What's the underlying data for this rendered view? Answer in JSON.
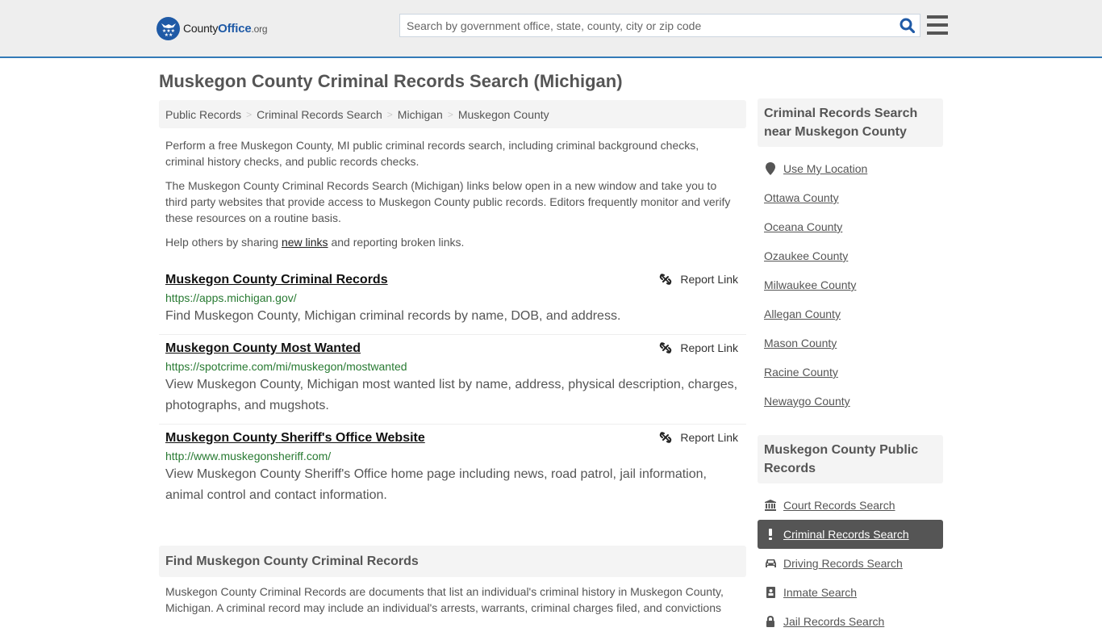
{
  "header": {
    "logo": {
      "name": "County",
      "highlight": "Office",
      "suffix": ".org"
    },
    "search": {
      "placeholder": "Search by government office, state, county, city or zip code",
      "value": ""
    },
    "accent_color": "#337ab7"
  },
  "page": {
    "title": "Muskegon County Criminal Records Search (Michigan)"
  },
  "breadcrumb": [
    "Public Records",
    "Criminal Records Search",
    "Michigan",
    "Muskegon County"
  ],
  "intro": {
    "p1": "Perform a free Muskegon County, MI public criminal records search, including criminal background checks, criminal history checks, and public records checks.",
    "p2": "The Muskegon County Criminal Records Search (Michigan) links below open in a new window and take you to third party websites that provide access to Muskegon County public records. Editors frequently monitor and verify these resources on a routine basis.",
    "p3_before": "Help others by sharing ",
    "p3_link": "new links",
    "p3_after": " and reporting broken links."
  },
  "links": [
    {
      "title": "Muskegon County Criminal Records",
      "url": "https://apps.michigan.gov/",
      "description": "Find Muskegon County, Michigan criminal records by name, DOB, and address.",
      "report_label": "Report Link"
    },
    {
      "title": "Muskegon County Most Wanted",
      "url": "https://spotcrime.com/mi/muskegon/mostwanted",
      "description": "View Muskegon County, Michigan most wanted list by name, address, physical description, charges, photographs, and mugshots.",
      "report_label": "Report Link"
    },
    {
      "title": "Muskegon County Sheriff's Office Website",
      "url": "http://www.muskegonsheriff.com/",
      "description": "View Muskegon County Sheriff's Office home page including news, road patrol, jail information, animal control and contact information.",
      "report_label": "Report Link"
    }
  ],
  "find_section": {
    "heading": "Find Muskegon County Criminal Records",
    "body": "Muskegon County Criminal Records are documents that list an individual's criminal history in Muskegon County, Michigan. A criminal record may include an individual's arrests, warrants, criminal charges filed, and convictions"
  },
  "sidebar": {
    "nearby": {
      "heading": "Criminal Records Search near Muskegon County",
      "use_location": "Use My Location",
      "counties": [
        "Ottawa County",
        "Oceana County",
        "Ozaukee County",
        "Milwaukee County",
        "Allegan County",
        "Mason County",
        "Racine County",
        "Newaygo County"
      ]
    },
    "public_records": {
      "heading": "Muskegon County Public Records",
      "items": [
        {
          "label": "Court Records Search",
          "icon": "courthouse-icon",
          "active": false
        },
        {
          "label": "Criminal Records Search",
          "icon": "exclamation-icon",
          "active": true
        },
        {
          "label": "Driving Records Search",
          "icon": "car-icon",
          "active": false
        },
        {
          "label": "Inmate Search",
          "icon": "id-badge-icon",
          "active": false
        },
        {
          "label": "Jail Records Search",
          "icon": "lock-icon",
          "active": false
        }
      ]
    }
  }
}
